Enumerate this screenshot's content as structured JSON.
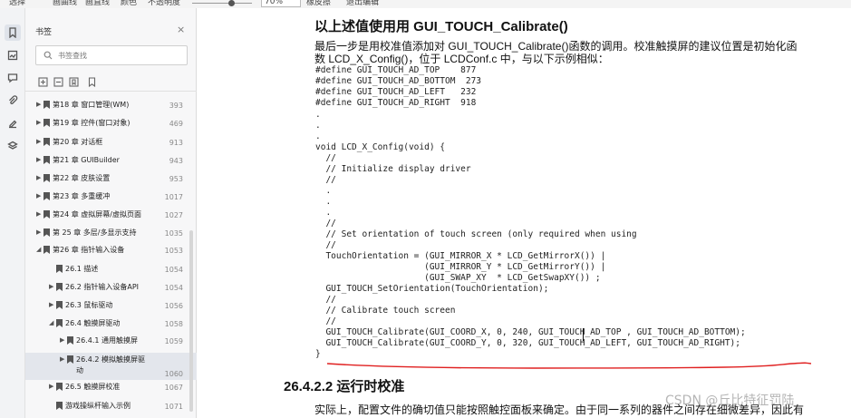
{
  "toolbar": {
    "items": [
      "选择",
      "画曲线",
      "画直线",
      "颜色",
      "不透明度"
    ],
    "zoom": "70%",
    "menu2": [
      "橡皮擦",
      "退出编辑"
    ]
  },
  "rail": {
    "icons": [
      "bookmark-icon",
      "thumbnail-icon",
      "comment-icon",
      "attachment-icon",
      "signature-icon",
      "layers-icon"
    ]
  },
  "panel": {
    "title": "书签",
    "close": "×",
    "search_placeholder": "书签查找",
    "tools": [
      "expand-icon",
      "collapse-icon",
      "add-bookmark-icon",
      "bookmark-outline-icon"
    ]
  },
  "bookmarks": [
    {
      "label": "第18 章 窗口管理(WM)",
      "page": "393"
    },
    {
      "label": "第19 章 控件(窗口对象)",
      "page": "469"
    },
    {
      "label": "第20 章 对话框",
      "page": "913"
    },
    {
      "label": "第21 章 GUIBuilder",
      "page": "943"
    },
    {
      "label": "第22 章 皮肤设置",
      "page": "953"
    },
    {
      "label": "第23 章 多重缓冲",
      "page": "1017"
    },
    {
      "label": "第24 章 虚拟屏幕/虚拟页面",
      "page": "1027"
    },
    {
      "label": "第 25 章 多层/多显示支持",
      "page": "1035"
    },
    {
      "label": "第26 章 指针输入设备",
      "page": "1053"
    },
    {
      "label": "26.1 描述",
      "page": "1054"
    },
    {
      "label": "26.2 指针输入设备API",
      "page": "1054"
    },
    {
      "label": "26.3 鼠标驱动",
      "page": "1056"
    },
    {
      "label": "26.4 触摸屏驱动",
      "page": "1058"
    },
    {
      "label": "26.4.1 通用触摸屏",
      "page": "1059"
    },
    {
      "label": "26.4.2 模拟触摸屏驱",
      "label2": "动",
      "page": "1060"
    },
    {
      "label": "26.5 触摸屏校准",
      "page": "1067"
    },
    {
      "label": "游戏操纵杆输入示例",
      "page": "1071"
    }
  ],
  "document": {
    "heading": "以上述值使用用 GUI_TOUCH_Calibrate()",
    "para1": "最后一步是用校准值添加对 GUI_TOUCH_Calibrate()函数的调用。校准触摸屏的建议位置是初始化函",
    "para2": "数 LCD_X_Config()，位于 LCDConf.c 中，与以下示例相似：",
    "code": [
      "#define GUI_TOUCH_AD_TOP    877",
      "#define GUI_TOUCH_AD_BOTTOM  273",
      "#define GUI_TOUCH_AD_LEFT   232",
      "#define GUI_TOUCH_AD_RIGHT  918",
      ".",
      ".",
      ".",
      "void LCD_X_Config(void) {",
      "  //",
      "  // Initialize display driver",
      "  //",
      "  .",
      "  .",
      "  .",
      "  //",
      "  // Set orientation of touch screen (only required when using",
      "  //",
      "  TouchOrientation = (GUI_MIRROR_X * LCD_GetMirrorX()) |",
      "                     (GUI_MIRROR_Y * LCD_GetMirrorY()) |",
      "                     (GUI_SWAP_XY  * LCD_GetSwapXY()) ;",
      "  GUI_TOUCH_SetOrientation(TouchOrientation);",
      "  //",
      "  // Calibrate touch screen",
      "  //",
      "  GUI_TOUCH_Calibrate(GUI_COORD_X, 0, 240, GUI_TOUCH_AD_TOP , GUI_TOUCH_AD_BOTTOM);",
      "  GUI_TOUCH_Calibrate(GUI_COORD_Y, 0, 320, GUI_TOUCH_AD_LEFT, GUI_TOUCH_AD_RIGHT);",
      "}"
    ],
    "section_heading": "26.4.2.2  运行时校准",
    "para3": "实际上，配置文件的确切值只能按照触控面板来确定。由于同一系列的器件之间存在细微差异，因此有",
    "watermark": "CSDN @丘比特征罚陆"
  },
  "colors": {
    "annotation_red": "#e02020",
    "selected_bg": "#e3e6ec"
  }
}
